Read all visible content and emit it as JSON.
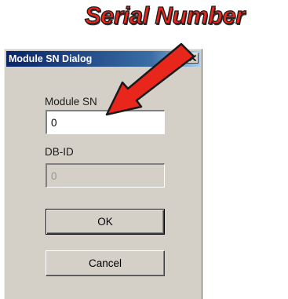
{
  "annotation": {
    "text": "Serial Number",
    "color": "#e8261c",
    "arrow_color": "#e8261c"
  },
  "dialog": {
    "title": "Module SN Dialog",
    "close_icon": "close-icon",
    "module_sn": {
      "label": "Module SN",
      "value": "0"
    },
    "db_id": {
      "label": "DB-ID",
      "value": "0",
      "disabled": true
    },
    "ok_label": "OK",
    "cancel_label": "Cancel",
    "colors": {
      "face": "#d4d0c8",
      "titlebar": "#0a246a"
    }
  }
}
